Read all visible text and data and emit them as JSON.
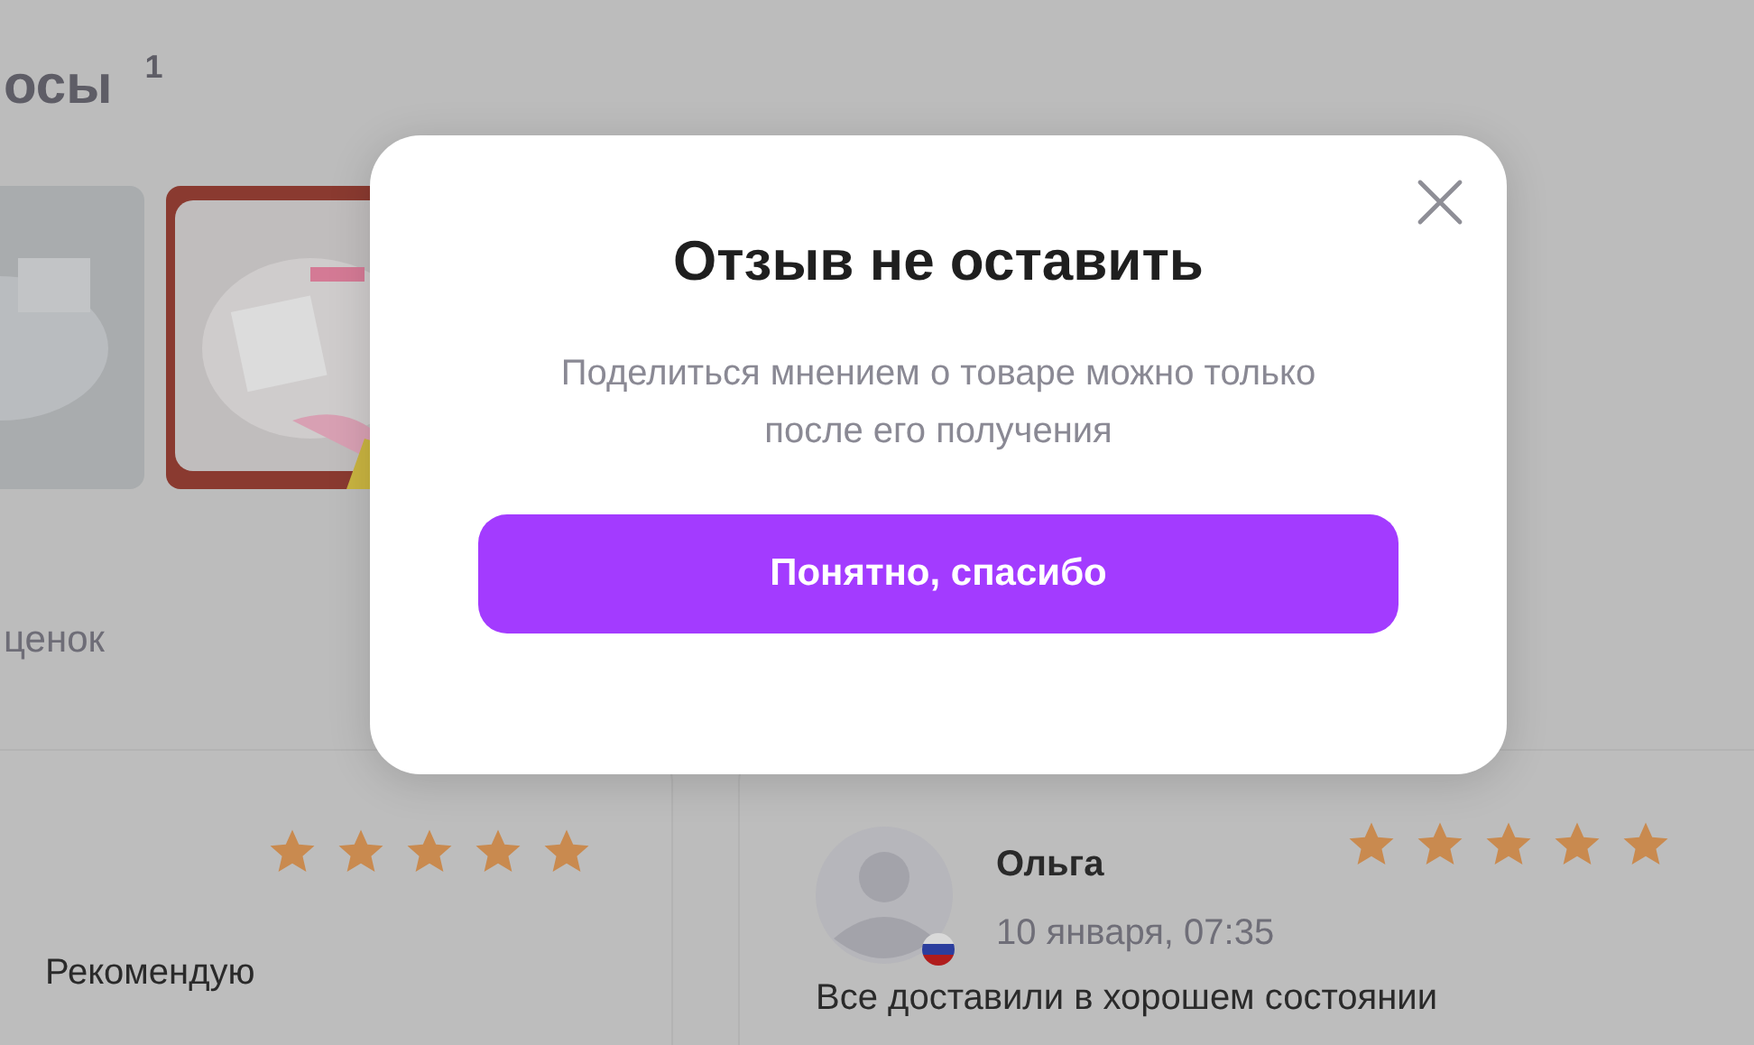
{
  "page": {
    "heading": "осы",
    "heading_count": "1",
    "ratings_label": "ценок",
    "reviews": [
      {
        "stars": 5,
        "text": "Рекомендую"
      },
      {
        "author": "Ольга",
        "date": "10 января, 07:35",
        "stars": 5,
        "text": "Все доставили в хорошем состоянии"
      }
    ]
  },
  "dialog": {
    "title": "Отзыв не оставить",
    "message": "Поделиться мнением о товаре можно только после его получения",
    "button": "Понятно, спасибо"
  }
}
